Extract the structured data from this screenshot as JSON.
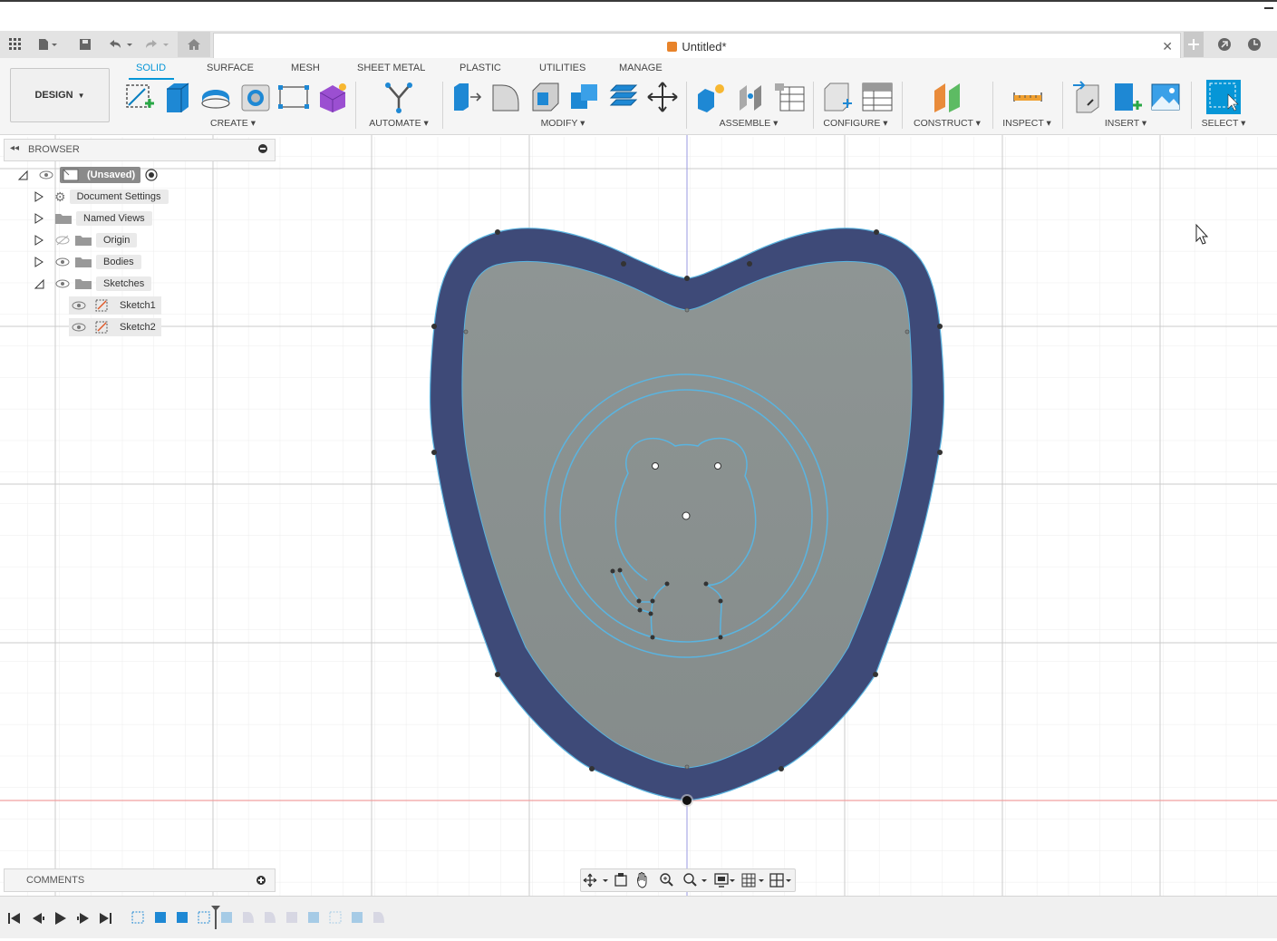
{
  "document": {
    "title": "Untitled*"
  },
  "workspace": {
    "label": "DESIGN"
  },
  "tabs": [
    {
      "label": "SOLID",
      "active": true
    },
    {
      "label": "SURFACE"
    },
    {
      "label": "MESH"
    },
    {
      "label": "SHEET METAL"
    },
    {
      "label": "PLASTIC"
    },
    {
      "label": "UTILITIES"
    },
    {
      "label": "MANAGE"
    }
  ],
  "groups": {
    "create": "CREATE",
    "automate": "AUTOMATE",
    "modify": "MODIFY",
    "assemble": "ASSEMBLE",
    "configure": "CONFIGURE",
    "construct": "CONSTRUCT",
    "inspect": "INSPECT",
    "insert": "INSERT",
    "select": "SELECT"
  },
  "browser": {
    "title": "BROWSER",
    "root": "(Unsaved)",
    "items": [
      {
        "label": "Document Settings",
        "icon": "gear-icon"
      },
      {
        "label": "Named Views",
        "icon": "folder-icon"
      },
      {
        "label": "Origin",
        "icon": "folder-icon"
      },
      {
        "label": "Bodies",
        "icon": "folder-icon"
      },
      {
        "label": "Sketches",
        "icon": "folder-icon"
      }
    ],
    "sketches": [
      {
        "label": "Sketch1"
      },
      {
        "label": "Sketch2"
      }
    ]
  },
  "comments": {
    "title": "COMMENTS"
  },
  "colors": {
    "accent": "#0696d7",
    "shield_outer": "#3e4a78",
    "shield_inner": "#8a9190",
    "sketch_line": "#5ab4e0",
    "axis_red": "#f0a0a0",
    "axis_blue": "#9a9ae0"
  }
}
